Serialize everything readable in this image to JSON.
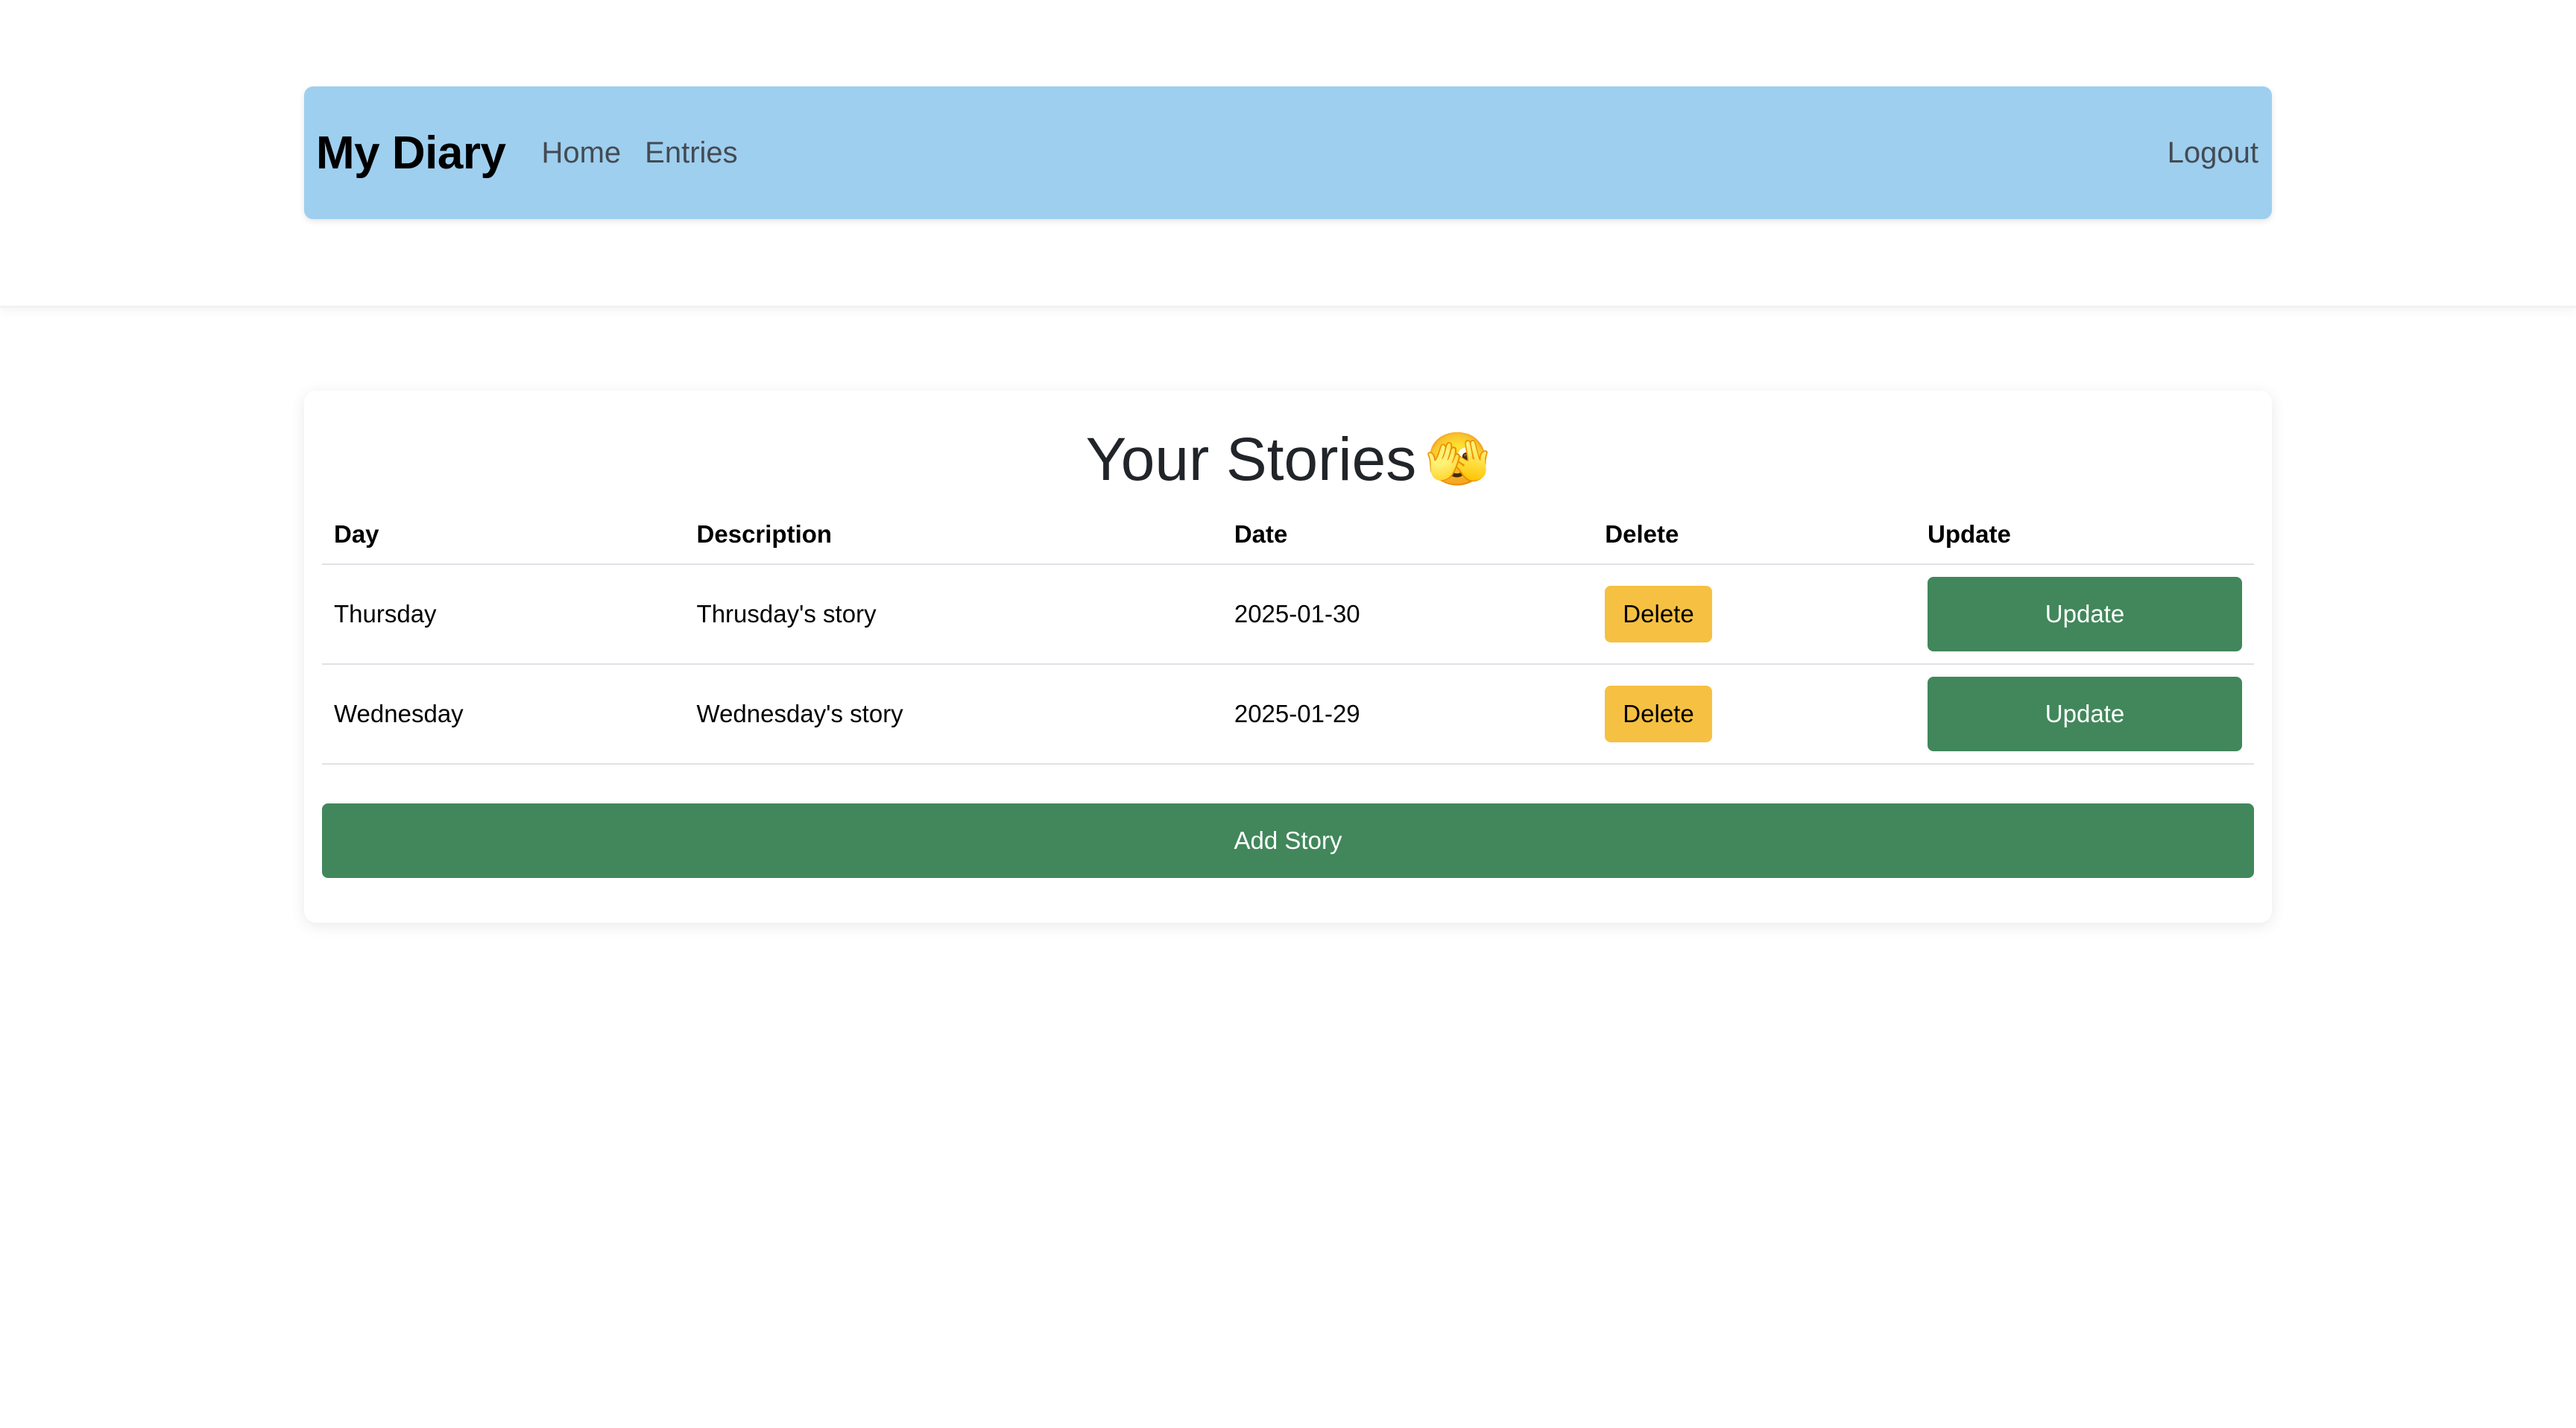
{
  "nav": {
    "brand": "My Diary",
    "links": [
      "Home",
      "Entries"
    ],
    "logout": "Logout",
    "background": "#9ecfef"
  },
  "card": {
    "title": "Your Stories",
    "title_emoji": "🫣",
    "columns": [
      "Day",
      "Description",
      "Date",
      "Delete",
      "Update"
    ],
    "rows": [
      {
        "day": "Thursday",
        "description": "Thrusday's story",
        "date": "2025-01-30",
        "delete_label": "Delete",
        "update_label": "Update"
      },
      {
        "day": "Wednesday",
        "description": "Wednesday's story",
        "date": "2025-01-29",
        "delete_label": "Delete",
        "update_label": "Update"
      }
    ],
    "add_label": "Add Story"
  },
  "colors": {
    "delete_button": "#f6c142",
    "update_button": "#41875b",
    "add_button": "#41875b"
  }
}
